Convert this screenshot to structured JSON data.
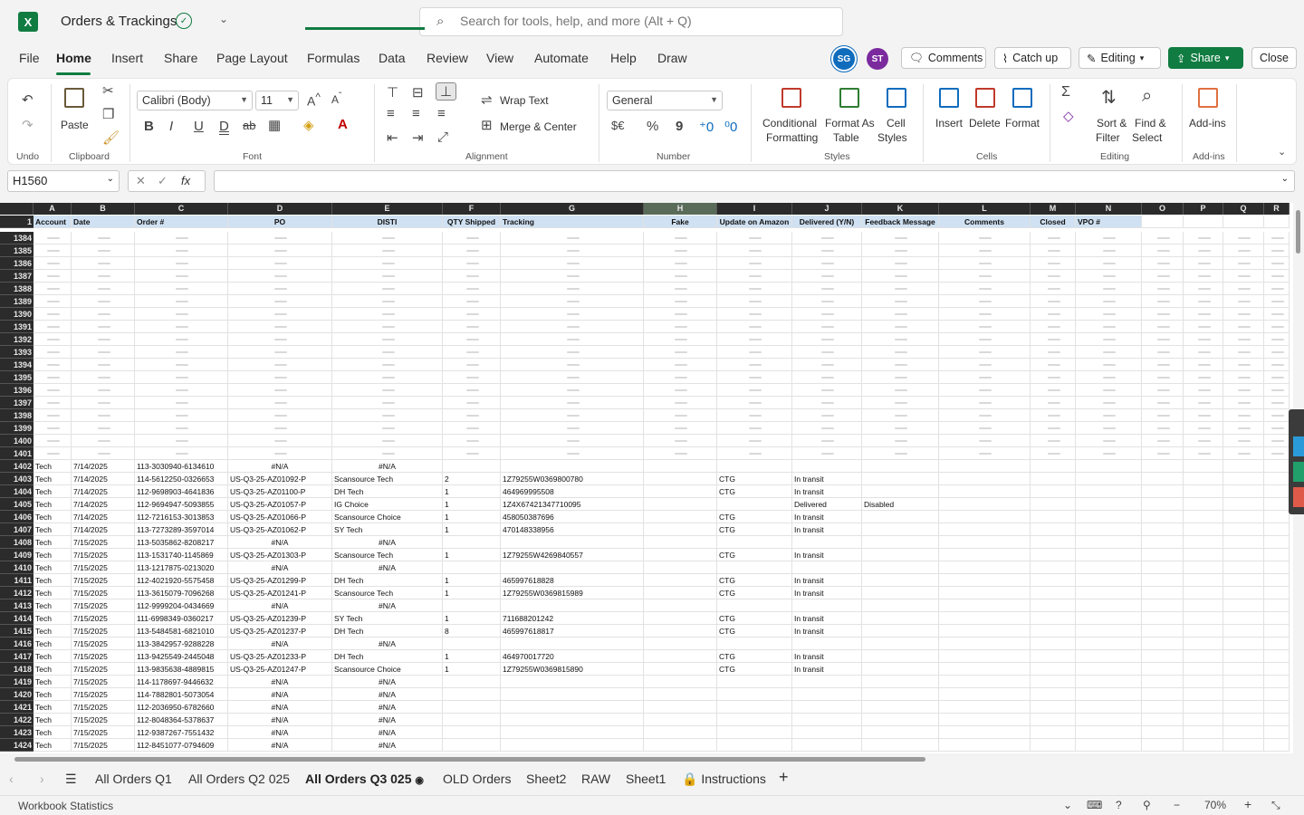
{
  "app": {
    "title": "Orders & Trackings",
    "logo": "X"
  },
  "search": {
    "placeholder": "Search for tools, help, and more (Alt + Q)"
  },
  "menu": [
    "File",
    "Home",
    "Insert",
    "Share",
    "Page Layout",
    "Formulas",
    "Data",
    "Review",
    "View",
    "Automate",
    "Help",
    "Draw"
  ],
  "users": [
    "SG",
    "ST"
  ],
  "toolbar": {
    "comments": "Comments",
    "catchup": "Catch up",
    "editing": "Editing",
    "share": "Share",
    "close": "Close"
  },
  "ribbon": {
    "undo_group": "Undo",
    "clipboard": {
      "paste": "Paste",
      "label": "Clipboard"
    },
    "font": {
      "name": "Calibri (Body)",
      "size": "11",
      "label": "Font",
      "bold": "B",
      "italic": "I",
      "underline": "U",
      "dunder": "D",
      "strike": "ab",
      "incr": "A^",
      "decr": "A^"
    },
    "alignment": {
      "wrap": "Wrap Text",
      "merge": "Merge & Center",
      "label": "Alignment"
    },
    "number": {
      "format": "General",
      "label": "Number",
      "currency": "$€",
      "percent": "%",
      "comma": "9"
    },
    "styles": {
      "cond1": "Conditional",
      "cond2": "Formatting",
      "fmt1": "Format As",
      "fmt2": "Table",
      "cell1": "Cell",
      "cell2": "Styles",
      "label": "Styles"
    },
    "cells": {
      "insert": "Insert",
      "delete": "Delete",
      "format": "Format",
      "label": "Cells"
    },
    "editing": {
      "sum": "Σ",
      "sort1": "Sort &",
      "sort2": "Filter",
      "find1": "Find &",
      "find2": "Select",
      "label": "Editing"
    },
    "addins": {
      "name": "Add-ins",
      "label": "Add-ins"
    }
  },
  "formula": {
    "namebox": "H1560",
    "fx": "fx",
    "value": ""
  },
  "grid": {
    "columns": [
      "A",
      "B",
      "C",
      "D",
      "E",
      "F",
      "G",
      "H",
      "I",
      "J",
      "K",
      "L",
      "M",
      "N",
      "O",
      "P",
      "Q",
      "R"
    ],
    "header_row": "1",
    "headers": [
      "Account",
      "Date",
      "Order #",
      "PO",
      "DISTI",
      "QTY Shipped",
      "Tracking",
      "Fake",
      "Update on Amazon",
      "Delivered (Y/N)",
      "Feedback Message",
      "Comments",
      "Closed",
      "VPO #",
      "",
      "",
      "",
      ""
    ],
    "empty_rows": [
      "1384",
      "1385",
      "1386",
      "1387",
      "1388",
      "1389",
      "1390",
      "1391",
      "1392",
      "1393",
      "1394",
      "1395",
      "1396",
      "1397",
      "1398",
      "1399",
      "1400",
      "1401"
    ],
    "rows": [
      [
        "1402",
        "Tech",
        "7/14/2025",
        "113-3030940-6134610",
        "#N/A",
        "#N/A",
        "",
        "",
        "",
        "",
        "",
        ""
      ],
      [
        "1403",
        "Tech",
        "7/14/2025",
        "114-5612250-0326653",
        "US-Q3-25-AZ01092-P",
        "Scansource Tech",
        "2",
        "1Z79255W0369800780",
        "",
        "CTG",
        "In transit",
        ""
      ],
      [
        "1404",
        "Tech",
        "7/14/2025",
        "112-9698903-4641836",
        "US-Q3-25-AZ01100-P",
        "DH Tech",
        "1",
        "464969995508",
        "",
        "CTG",
        "In transit",
        ""
      ],
      [
        "1405",
        "Tech",
        "7/14/2025",
        "112-9694947-5093855",
        "US-Q3-25-AZ01057-P",
        "IG Choice",
        "1",
        "1Z4X67421347710095",
        "",
        "",
        "Delivered",
        "Disabled"
      ],
      [
        "1406",
        "Tech",
        "7/14/2025",
        "112-7216153-3013853",
        "US-Q3-25-AZ01066-P",
        "Scansource Choice",
        "1",
        "458050387696",
        "",
        "CTG",
        "In transit",
        ""
      ],
      [
        "1407",
        "Tech",
        "7/14/2025",
        "113-7273289-3597014",
        "US-Q3-25-AZ01062-P",
        "SY Tech",
        "1",
        "470148338956",
        "",
        "CTG",
        "In transit",
        ""
      ],
      [
        "1408",
        "Tech",
        "7/15/2025",
        "113-5035862-8208217",
        "#N/A",
        "#N/A",
        "",
        "",
        "",
        "",
        "",
        ""
      ],
      [
        "1409",
        "Tech",
        "7/15/2025",
        "113-1531740-1145869",
        "US-Q3-25-AZ01303-P",
        "Scansource Tech",
        "1",
        "1Z79255W4269840557",
        "",
        "CTG",
        "In transit",
        ""
      ],
      [
        "1410",
        "Tech",
        "7/15/2025",
        "113-1217875-0213020",
        "#N/A",
        "#N/A",
        "",
        "",
        "",
        "",
        "",
        ""
      ],
      [
        "1411",
        "Tech",
        "7/15/2025",
        "112-4021920-5575458",
        "US-Q3-25-AZ01299-P",
        "DH Tech",
        "1",
        "465997618828",
        "",
        "CTG",
        "In transit",
        ""
      ],
      [
        "1412",
        "Tech",
        "7/15/2025",
        "113-3615079-7096268",
        "US-Q3-25-AZ01241-P",
        "Scansource Tech",
        "1",
        "1Z79255W0369815989",
        "",
        "CTG",
        "In transit",
        ""
      ],
      [
        "1413",
        "Tech",
        "7/15/2025",
        "112-9999204-0434669",
        "#N/A",
        "#N/A",
        "",
        "",
        "",
        "",
        "",
        ""
      ],
      [
        "1414",
        "Tech",
        "7/15/2025",
        "111-6998349-0360217",
        "US-Q3-25-AZ01239-P",
        "SY Tech",
        "1",
        "711688201242",
        "",
        "CTG",
        "In transit",
        ""
      ],
      [
        "1415",
        "Tech",
        "7/15/2025",
        "113-5484581-6821010",
        "US-Q3-25-AZ01237-P",
        "DH Tech",
        "8",
        "465997618817",
        "",
        "CTG",
        "In transit",
        ""
      ],
      [
        "1416",
        "Tech",
        "7/15/2025",
        "113-3842957-9288228",
        "#N/A",
        "#N/A",
        "",
        "",
        "",
        "",
        "",
        ""
      ],
      [
        "1417",
        "Tech",
        "7/15/2025",
        "113-9425549-2445048",
        "US-Q3-25-AZ01233-P",
        "DH Tech",
        "1",
        "464970017720",
        "",
        "CTG",
        "In transit",
        ""
      ],
      [
        "1418",
        "Tech",
        "7/15/2025",
        "113-9835638-4889815",
        "US-Q3-25-AZ01247-P",
        "Scansource Choice",
        "1",
        "1Z79255W0369815890",
        "",
        "CTG",
        "In transit",
        ""
      ],
      [
        "1419",
        "Tech",
        "7/15/2025",
        "114-1178697-9446632",
        "#N/A",
        "#N/A",
        "",
        "",
        "",
        "",
        "",
        ""
      ],
      [
        "1420",
        "Tech",
        "7/15/2025",
        "114-7882801-5073054",
        "#N/A",
        "#N/A",
        "",
        "",
        "",
        "",
        "",
        ""
      ],
      [
        "1421",
        "Tech",
        "7/15/2025",
        "112-2036950-6782660",
        "#N/A",
        "#N/A",
        "",
        "",
        "",
        "",
        "",
        ""
      ],
      [
        "1422",
        "Tech",
        "7/15/2025",
        "112-8048364-5378637",
        "#N/A",
        "#N/A",
        "",
        "",
        "",
        "",
        "",
        ""
      ],
      [
        "1423",
        "Tech",
        "7/15/2025",
        "112-9387267-7551432",
        "#N/A",
        "#N/A",
        "",
        "",
        "",
        "",
        "",
        ""
      ],
      [
        "1424",
        "Tech",
        "7/15/2025",
        "112-8451077-0794609",
        "#N/A",
        "#N/A",
        "",
        "",
        "",
        "",
        "",
        ""
      ]
    ]
  },
  "sheets": [
    "All Orders Q1",
    "All Orders Q2 025",
    "All Orders Q3 025",
    "OLD Orders",
    "Sheet2",
    "RAW",
    "Sheet1",
    "Instructions"
  ],
  "active_sheet": "All Orders Q3 025",
  "status": {
    "left": "Workbook Statistics",
    "zoom": "70%"
  },
  "colors": {
    "accent": "#107c41",
    "header_fill": "#cfe1f2"
  }
}
